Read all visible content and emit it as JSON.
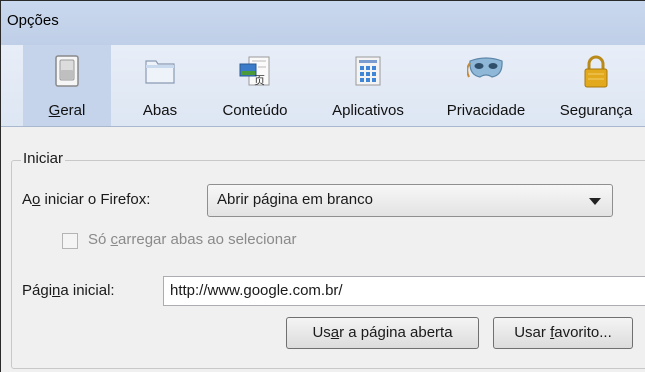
{
  "window": {
    "title": "Opções"
  },
  "panes": [
    {
      "label": "Geral",
      "underline_index": 0,
      "icon": "switch-icon",
      "selected": true
    },
    {
      "label": "Abas",
      "underline_index": -1,
      "icon": "tabs-folder-icon",
      "selected": false
    },
    {
      "label": "Conteúdo",
      "underline_index": -1,
      "icon": "content-document-icon",
      "selected": false
    },
    {
      "label": "Aplicativos",
      "underline_index": -1,
      "icon": "applications-icon",
      "selected": false
    },
    {
      "label": "Privacidade",
      "underline_index": -1,
      "icon": "privacy-mask-icon",
      "selected": false
    },
    {
      "label": "Segurança",
      "underline_index": -1,
      "icon": "security-lock-icon",
      "selected": false
    }
  ],
  "startup": {
    "legend": "Iniciar",
    "on_start_label_pre": "A",
    "on_start_label_ul": "o",
    "on_start_label_post": " iniciar o Firefox:",
    "on_start_value": "Abrir página em branco",
    "load_tabs_pre": "Só ",
    "load_tabs_ul": "c",
    "load_tabs_post": "arregar abas ao selecionar",
    "homepage_label_pre": "Pági",
    "homepage_label_ul": "n",
    "homepage_label_post": "a inicial:",
    "homepage_value": "http://www.google.com.br/",
    "use_current_pre": "Us",
    "use_current_ul": "a",
    "use_current_post": "r a página aberta",
    "use_bookmark_pre": "Usar ",
    "use_bookmark_ul": "f",
    "use_bookmark_post": "avorito..."
  },
  "colors": {
    "titlebar": "#c9d8ee",
    "toolbar": "#e1e9f5",
    "selected_pane": "#c5d4ea",
    "mask_blue": "#8fb8d8",
    "lock_gold": "#e2a91c"
  }
}
